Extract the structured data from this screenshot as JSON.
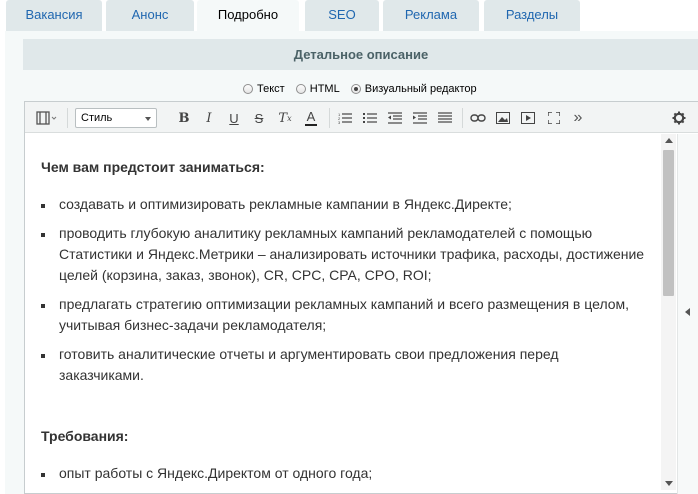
{
  "tabs": [
    {
      "label": "Вакансия",
      "active": false
    },
    {
      "label": "Анонс",
      "active": false
    },
    {
      "label": "Подробно",
      "active": true
    },
    {
      "label": "SEO",
      "active": false
    },
    {
      "label": "Реклама",
      "active": false
    },
    {
      "label": "Разделы",
      "active": false
    }
  ],
  "section": {
    "title": "Детальное описание"
  },
  "mode_switch": {
    "options": [
      {
        "label": "Текст",
        "checked": false
      },
      {
        "label": "HTML",
        "checked": false
      },
      {
        "label": "Визуальный редактор",
        "checked": true
      }
    ]
  },
  "toolbar": {
    "style_select": "Стиль",
    "bold": "B",
    "italic": "I",
    "underline": "U",
    "strike": "S",
    "clear_format": "T",
    "clear_format_sub": "x",
    "font_color": "A",
    "more": "»",
    "icons": [
      "view-mode-icon",
      "ordered-list-icon",
      "bullet-list-icon",
      "outdent-icon",
      "indent-icon",
      "justify-icon",
      "link-icon",
      "image-icon",
      "video-icon",
      "fullscreen-icon",
      "gear-icon"
    ]
  },
  "content": {
    "heading1": "Чем вам предстоит заниматься:",
    "list1": [
      "создавать и оптимизировать рекламные кампании в Яндекс.Директе;",
      "проводить глубокую аналитику рекламных кампаний рекламодателей с помощью Статистики и Яндекс.Метрики – анализировать источники трафика, расходы, достижение целей (корзина, заказ, звонок), CR, CPC, CPA, CPO, ROI;",
      "предлагать стратегию оптимизации рекламных кампаний и всего размещения в целом, учитывая бизнес-задачи рекламодателя;",
      "готовить аналитические отчеты и аргументировать свои предложения перед заказчиками."
    ],
    "heading2": "Требования:",
    "list2": [
      "опыт работы с Яндекс.Директом от одного года;"
    ]
  },
  "colors": {
    "tab_bg": "#e0e8ea",
    "tab_text": "#2067b0",
    "panel_bg": "#f5f9f9"
  }
}
